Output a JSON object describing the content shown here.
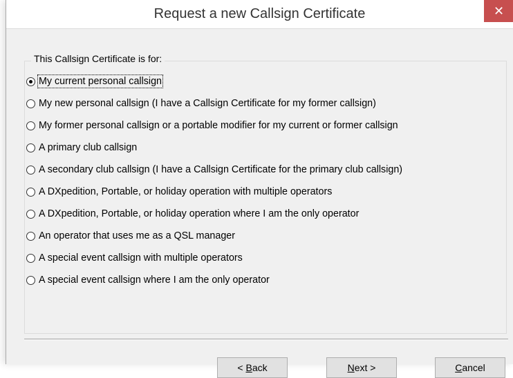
{
  "dialog": {
    "title": "Request a new Callsign Certificate",
    "close_glyph": "✕"
  },
  "group": {
    "legend": "This Callsign Certificate is for:",
    "options": [
      {
        "label": "My current personal callsign",
        "checked": true
      },
      {
        "label": "My new personal callsign (I have a Callsign Certificate for my former callsign)",
        "checked": false
      },
      {
        "label": "My former personal callsign or a portable modifier for my current or former callsign",
        "checked": false
      },
      {
        "label": "A primary club callsign",
        "checked": false
      },
      {
        "label": "A secondary club callsign (I have a Callsign Certificate for the primary club callsign)",
        "checked": false
      },
      {
        "label": "A DXpedition, Portable, or holiday operation with multiple operators",
        "checked": false
      },
      {
        "label": "A DXpedition, Portable, or holiday operation where I am the only operator",
        "checked": false
      },
      {
        "label": "An operator that uses me as a QSL manager",
        "checked": false
      },
      {
        "label": "A special event callsign with multiple operators",
        "checked": false
      },
      {
        "label": "A special event callsign where I am the only operator",
        "checked": false
      }
    ]
  },
  "buttons": {
    "back": {
      "prefix": "< ",
      "mnemonic": "B",
      "rest": "ack"
    },
    "next": {
      "mnemonic": "N",
      "rest": "ext >"
    },
    "cancel": {
      "mnemonic": "C",
      "rest": "ancel"
    }
  },
  "icons": {
    "close": "close-icon",
    "radio": "radio-button"
  },
  "colors": {
    "close_button": "#c74f4f",
    "window_background": "#f0f0f0",
    "titlebar_background": "#ffffff"
  }
}
